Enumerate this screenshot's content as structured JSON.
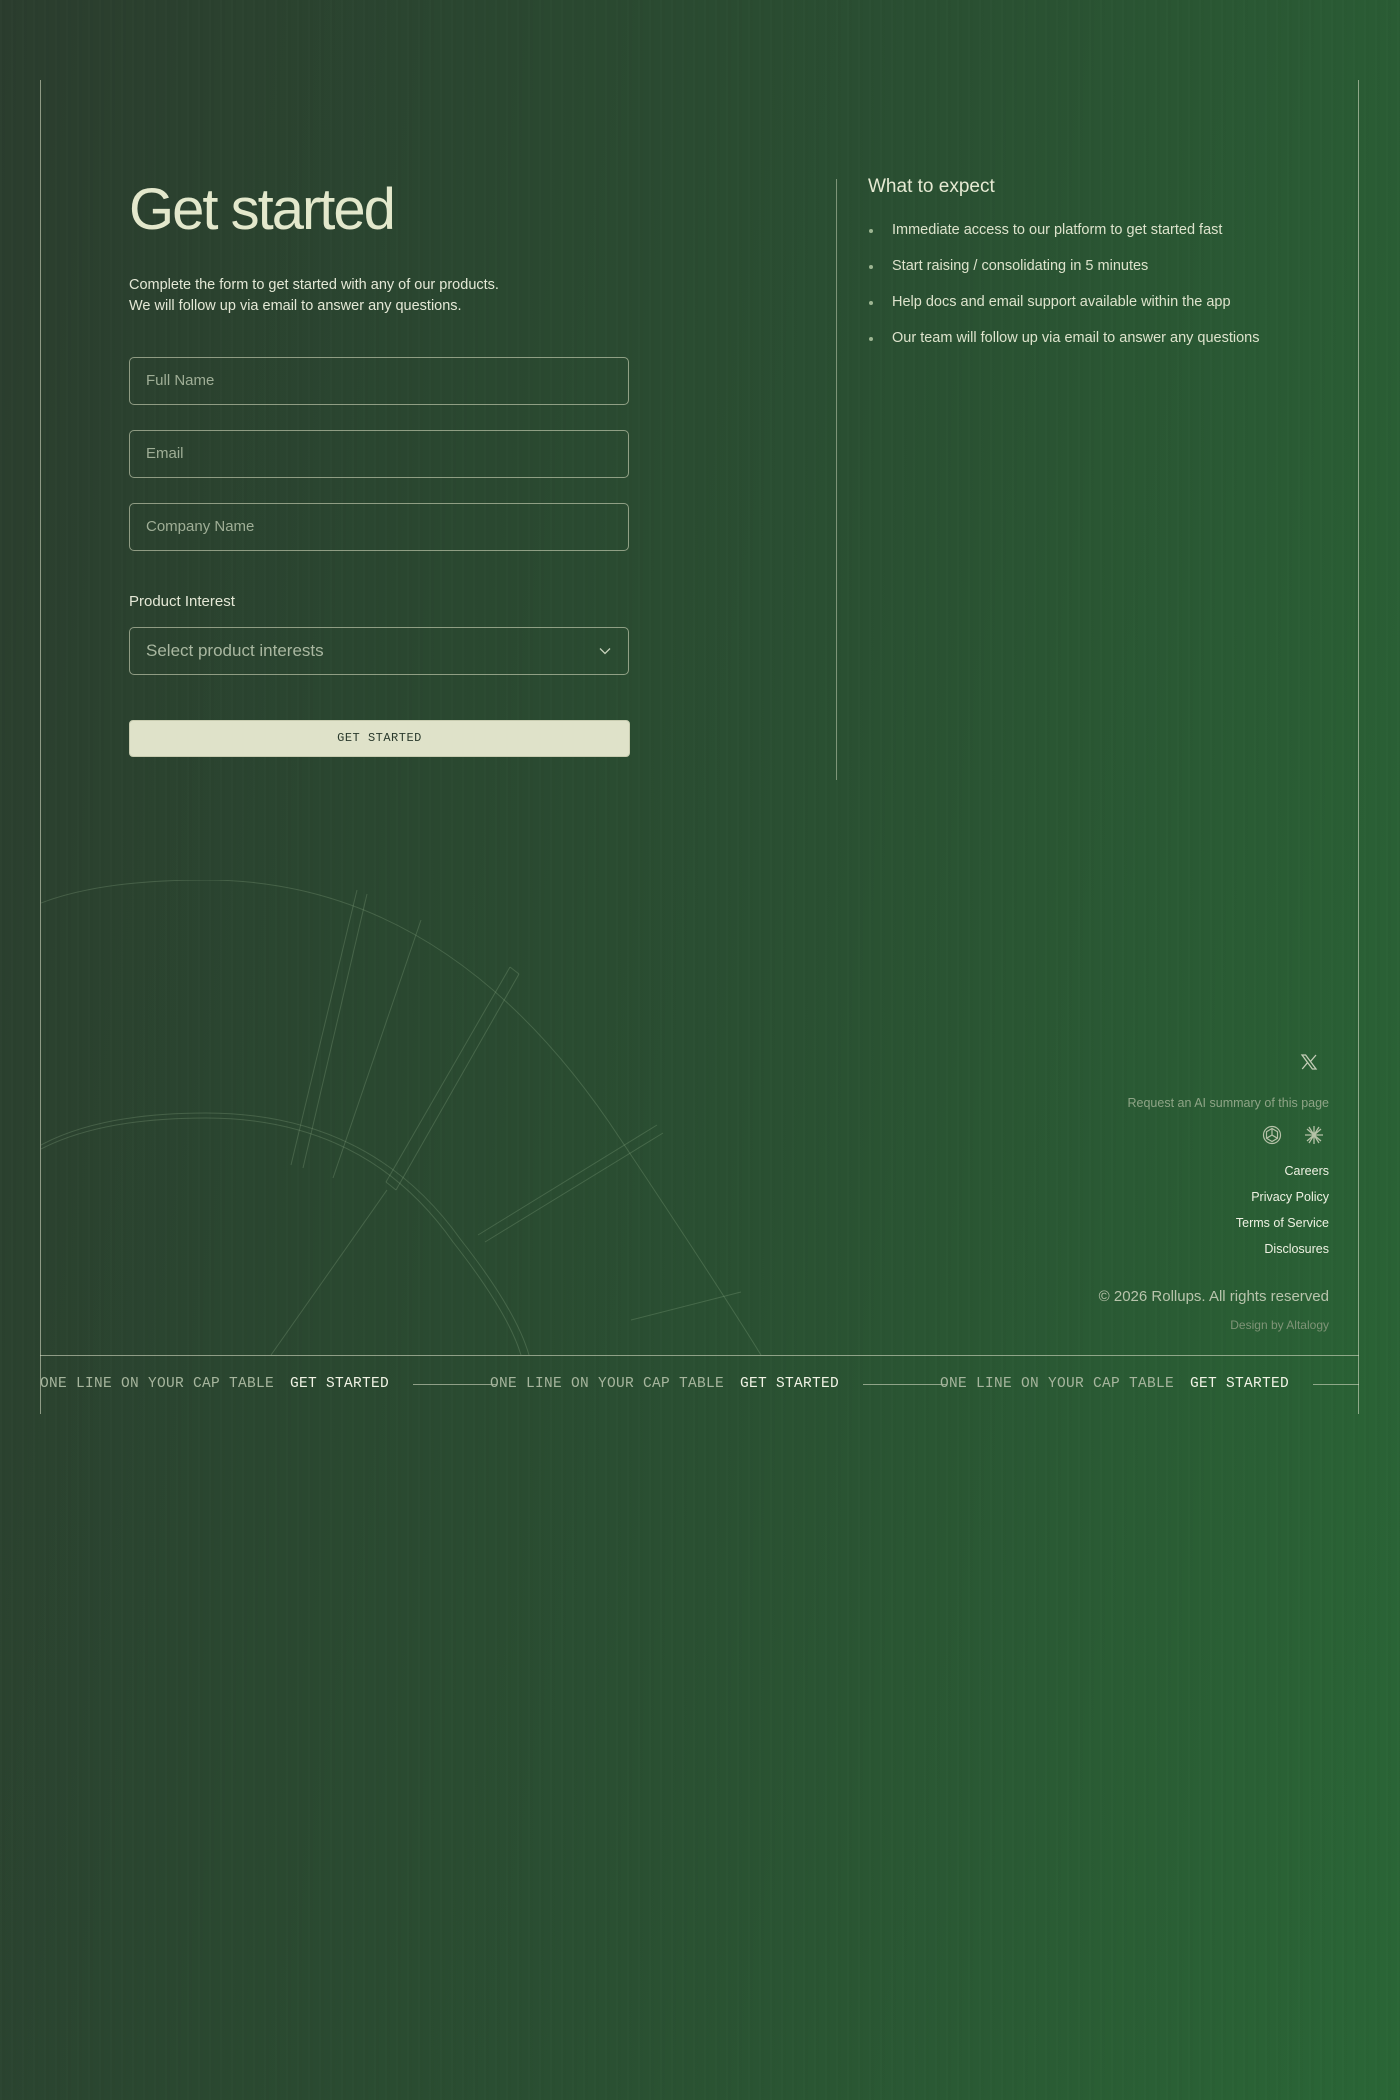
{
  "form": {
    "title": "Get started",
    "subtitle_line1": "Complete the form to get started with any of our products.",
    "subtitle_line2": "We will follow up via email to answer any questions.",
    "full_name": {
      "value": "",
      "placeholder": "Full Name"
    },
    "email": {
      "value": "",
      "placeholder": "Email"
    },
    "company_name": {
      "value": "",
      "placeholder": "Company Name"
    },
    "product_interest_label": "Product Interest",
    "product_interest_value": "Select product interests",
    "submit_label": "GET STARTED"
  },
  "expect": {
    "title": "What to expect",
    "items": [
      "Immediate access to our platform to get started fast",
      "Start raising / consolidating in 5 minutes",
      "Help docs and email support available within the app",
      "Our team will follow up via email to answer any questions"
    ]
  },
  "footer": {
    "social_icon": "x-icon",
    "ai_summary_label": "Request an AI summary of this page",
    "ai_icons": [
      "chatgpt-icon",
      "claude-icon"
    ],
    "links": [
      "Careers",
      "Privacy Policy",
      "Terms of Service",
      "Disclosures"
    ],
    "copyright": "© 2026  Rollups. All rights reserved",
    "design_credit": "Design by Altalogy"
  },
  "ticker": [
    {
      "label": "ONE LINE ON YOUR CAP TABLE",
      "cta": "GET STARTED"
    },
    {
      "label": "ONE LINE ON YOUR CAP TABLE",
      "cta": "GET STARTED"
    },
    {
      "label": "ONE LINE ON YOUR CAP TABLE",
      "cta": "GET STARTED"
    }
  ],
  "colors": {
    "background_start": "#2b3d2e",
    "background_end": "#2a6636",
    "accent_button": "#dfe2c9",
    "text_primary": "#e3e8cc"
  }
}
